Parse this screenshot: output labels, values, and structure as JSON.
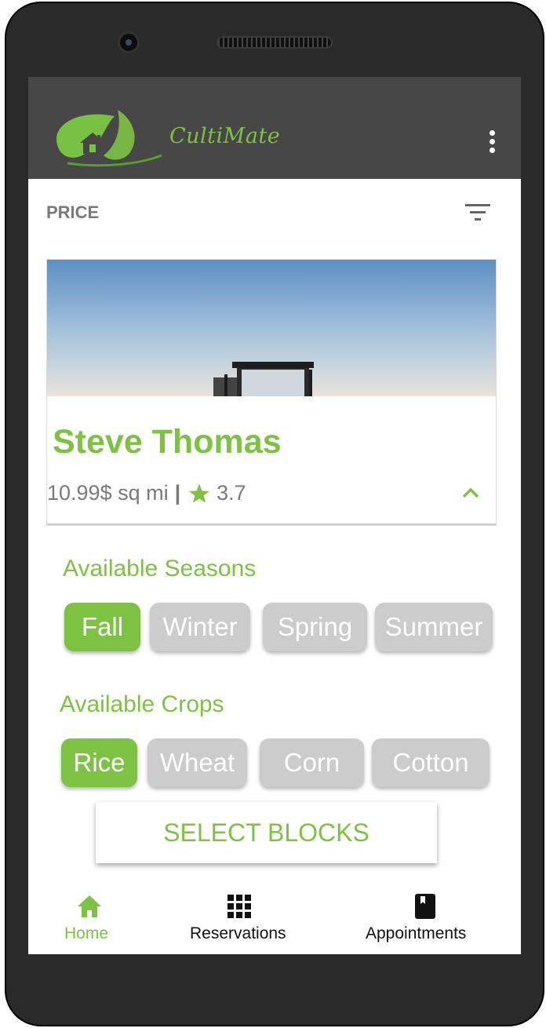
{
  "app": {
    "brand": "CultiMate",
    "accent": "#7dc243",
    "appbar_bg": "#474747"
  },
  "sort": {
    "label": "PRICE",
    "icon": "filter-icon"
  },
  "listing": {
    "name": "Steve Thomas",
    "price": "10.99$ sq mi",
    "separator": "|",
    "rating": "3.7",
    "image": "tractor-field-photo"
  },
  "seasons": {
    "title": "Available Seasons",
    "options": [
      {
        "label": "Fall",
        "selected": true
      },
      {
        "label": "Winter",
        "selected": false
      },
      {
        "label": "Spring",
        "selected": false
      },
      {
        "label": "Summer",
        "selected": false
      }
    ]
  },
  "crops": {
    "title": "Available Crops",
    "options": [
      {
        "label": "Rice",
        "selected": true
      },
      {
        "label": "Wheat",
        "selected": false
      },
      {
        "label": "Corn",
        "selected": false
      },
      {
        "label": "Cotton",
        "selected": false
      }
    ]
  },
  "action": {
    "select_blocks": "SELECT BLOCKS"
  },
  "bottom_nav": {
    "items": [
      {
        "label": "Home",
        "icon": "home-icon",
        "active": true
      },
      {
        "label": "Reservations",
        "icon": "grid-icon",
        "active": false
      },
      {
        "label": "Appointments",
        "icon": "book-icon",
        "active": false
      }
    ]
  }
}
